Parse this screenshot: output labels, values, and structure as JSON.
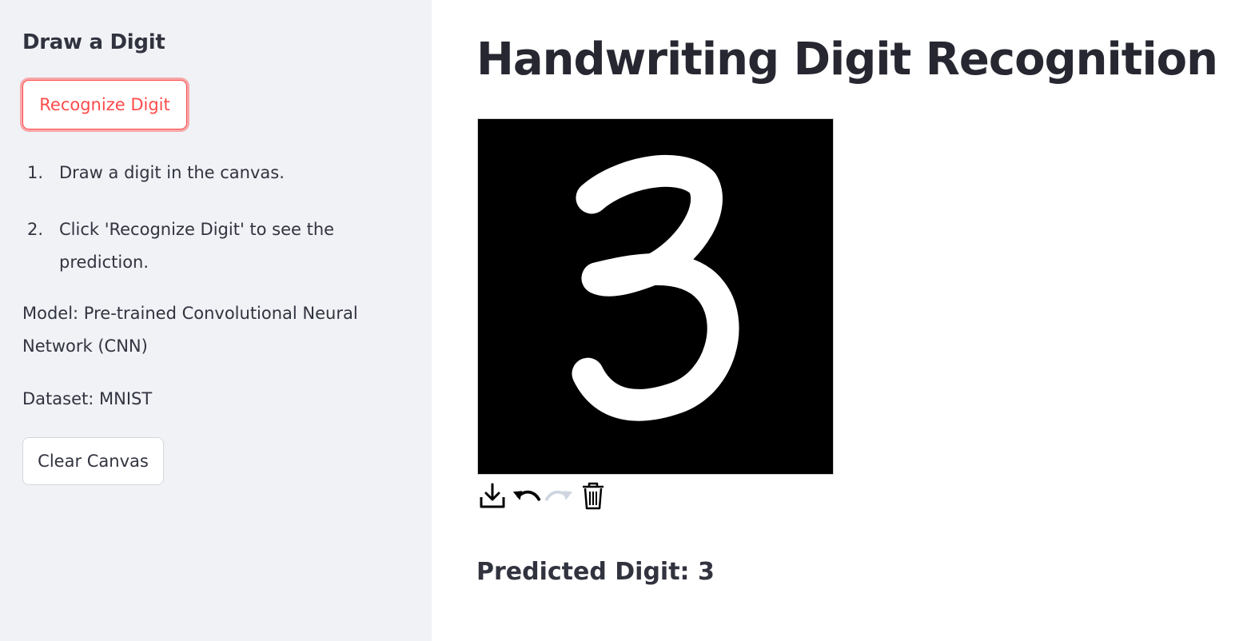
{
  "sidebar": {
    "heading": "Draw a Digit",
    "recognize_button": "Recognize Digit",
    "steps": [
      {
        "num": "1.",
        "text": "Draw a digit in the canvas."
      },
      {
        "num": "2.",
        "text": "Click 'Recognize Digit' to see the prediction."
      }
    ],
    "model_text": "Model: Pre-trained Convolutional Neural Network (CNN)",
    "dataset_text": "Dataset: MNIST",
    "clear_button": "Clear Canvas"
  },
  "main": {
    "title": "Handwriting Digit Recognition",
    "canvas": {
      "background_color": "#000000",
      "stroke_color": "#ffffff",
      "drawn_digit": "3"
    },
    "toolbar": {
      "icons": [
        "download-icon",
        "undo-icon",
        "redo-icon",
        "trash-icon"
      ],
      "redo_enabled": false
    },
    "prediction_text": "Predicted Digit: 3"
  },
  "colors": {
    "sidebar_bg": "#f0f2f6",
    "accent": "#ff4b4b",
    "text": "#31333f"
  }
}
